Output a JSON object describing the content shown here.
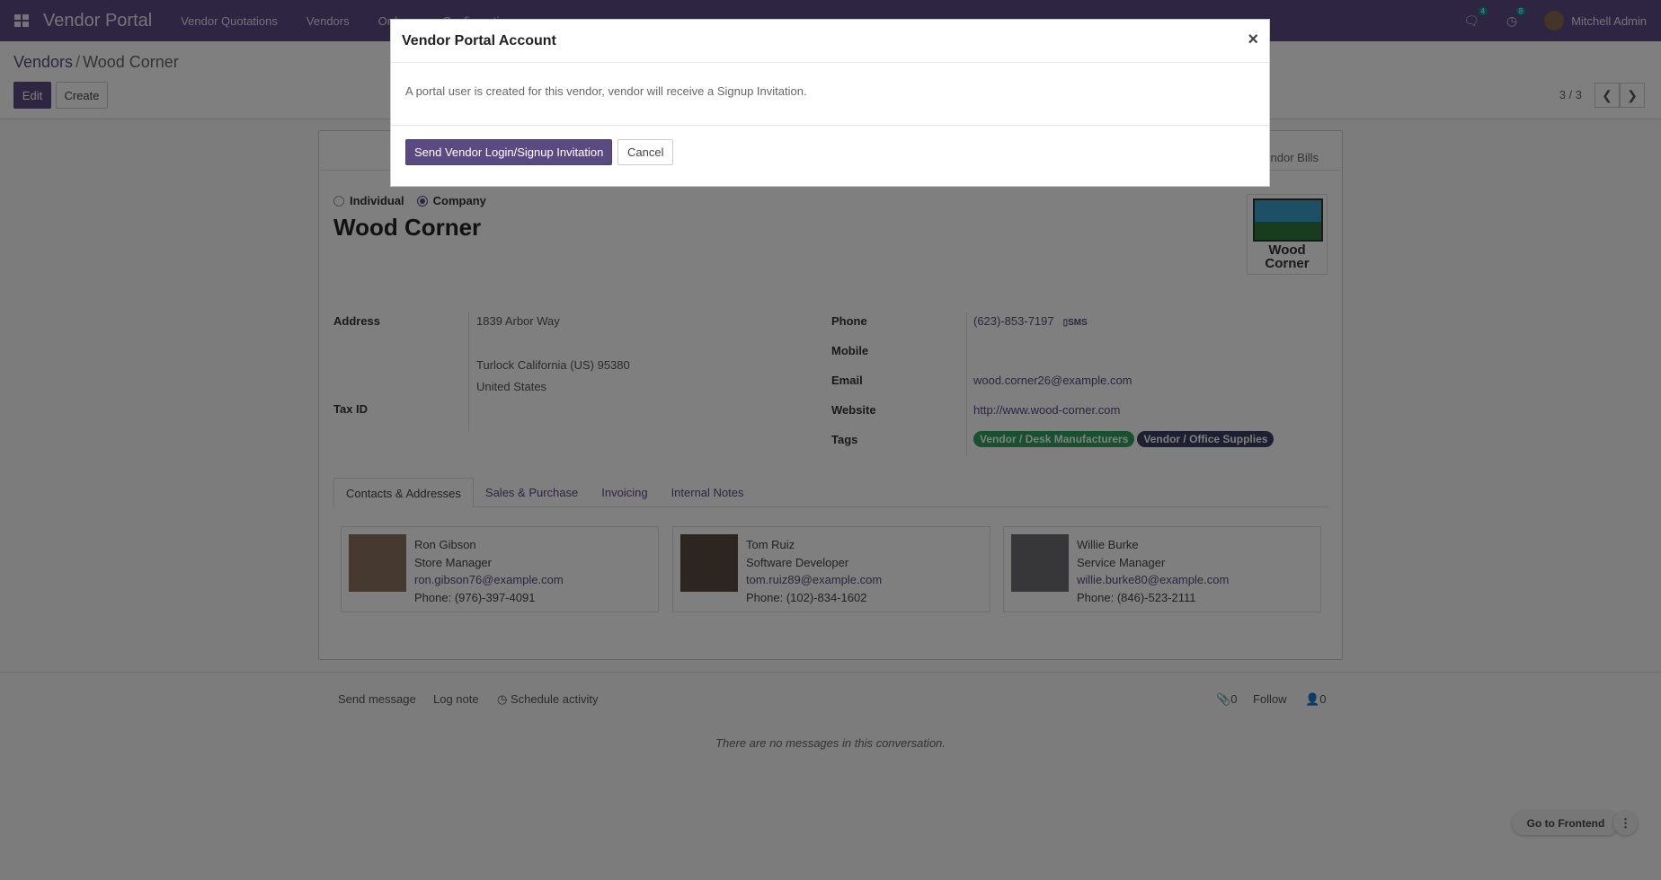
{
  "nav": {
    "brand": "Vendor Portal",
    "menu": [
      "Vendor Quotations",
      "Vendors",
      "Orders",
      "Configuration"
    ],
    "messages_count": "4",
    "activities_count": "8",
    "user": "Mitchell Admin"
  },
  "control": {
    "breadcrumb_parent": "Vendors",
    "breadcrumb_sep": "/",
    "breadcrumb_current": "Wood Corner",
    "edit_label": "Edit",
    "create_label": "Create",
    "pager": "3 / 3"
  },
  "form": {
    "smart_button": "ndor Bills",
    "type_individual": "Individual",
    "type_company": "Company",
    "name": "Wood Corner",
    "logo_text_1": "Wood",
    "logo_text_2": "Corner",
    "labels": {
      "address": "Address",
      "tax_id": "Tax ID",
      "phone": "Phone",
      "mobile": "Mobile",
      "email": "Email",
      "website": "Website",
      "tags": "Tags"
    },
    "address_line1": "1839 Arbor Way",
    "address_city_line": "Turlock  California (US)  95380",
    "address_country": "United States",
    "phone": "(623)-853-7197",
    "sms_label": "SMS",
    "email": "wood.corner26@example.com",
    "website": "http://www.wood-corner.com",
    "tags": [
      {
        "label": "Vendor / Desk Manufacturers",
        "color": "#30a35e"
      },
      {
        "label": "Vendor / Office Supplies",
        "color": "#3a3f67"
      }
    ],
    "tabs": [
      "Contacts & Addresses",
      "Sales & Purchase",
      "Invoicing",
      "Internal Notes"
    ],
    "contacts": [
      {
        "name": "Ron Gibson",
        "title": "Store Manager",
        "email": "ron.gibson76@example.com",
        "phone": "Phone: (976)-397-4091"
      },
      {
        "name": "Tom Ruiz",
        "title": "Software Developer",
        "email": "tom.ruiz89@example.com",
        "phone": "Phone: (102)-834-1602"
      },
      {
        "name": "Willie Burke",
        "title": "Service Manager",
        "email": "willie.burke80@example.com",
        "phone": "Phone: (846)-523-2111"
      }
    ]
  },
  "chatter": {
    "send_message": "Send message",
    "log_note": "Log note",
    "schedule_activity": "Schedule activity",
    "attachments_count": "0",
    "follow": "Follow",
    "followers_count": "0",
    "empty_text": "There are no messages in this conversation."
  },
  "footer": {
    "go_frontend": "Go to Frontend"
  },
  "modal": {
    "title": "Vendor Portal Account",
    "close": "×",
    "body": "A portal user is created for this vendor, vendor will receive a Signup Invitation.",
    "primary_label": "Send Vendor Login/Signup Invitation",
    "cancel_label": "Cancel"
  }
}
